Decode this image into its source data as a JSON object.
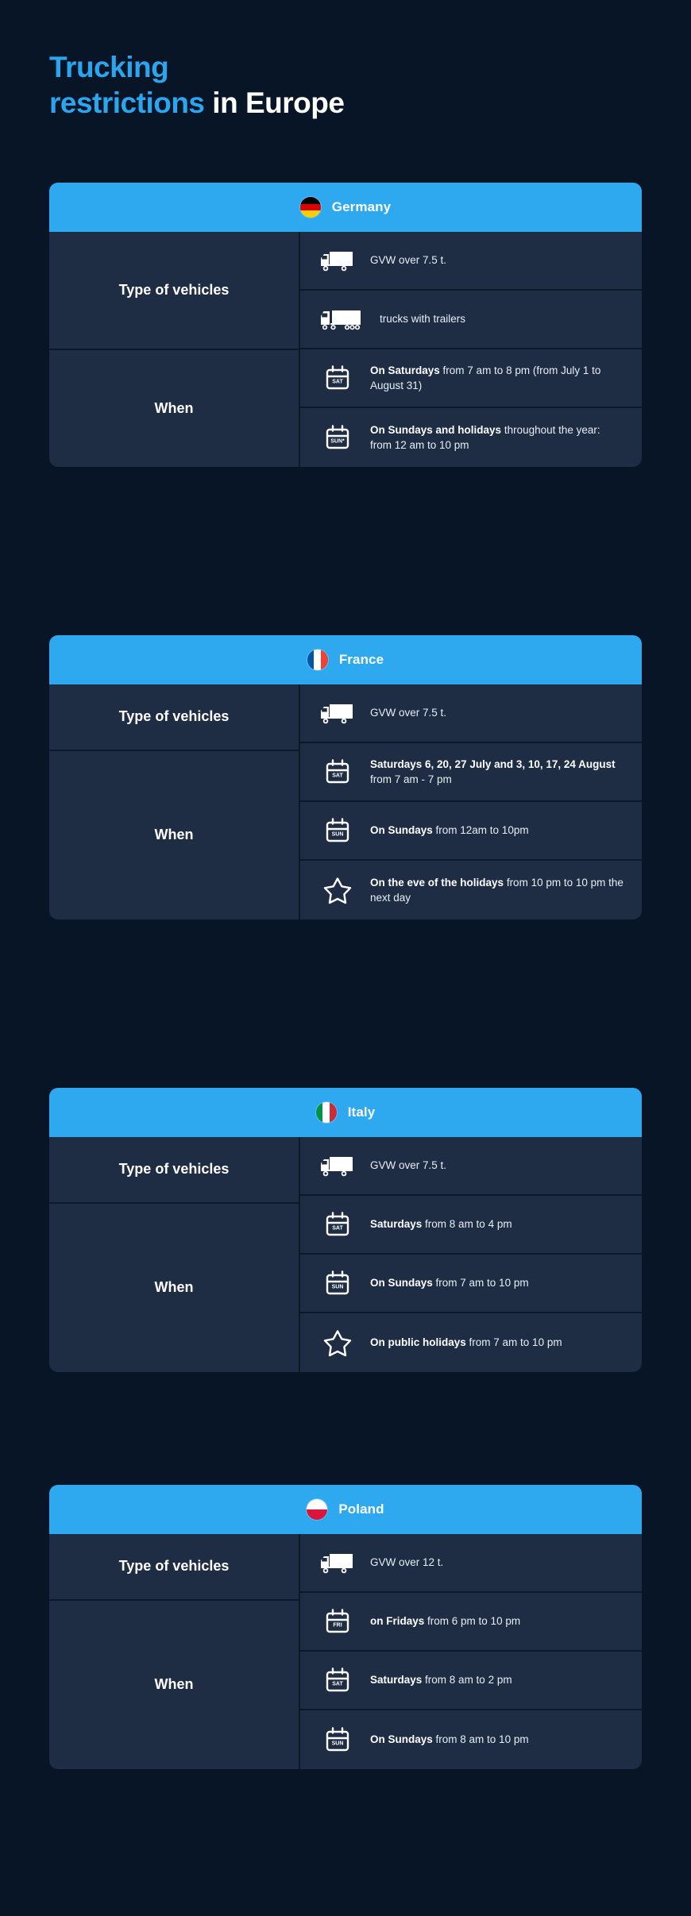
{
  "title": {
    "line1_blue": "Trucking",
    "line2_blue": "restrictions",
    "line2_white": " in Europe"
  },
  "colors": {
    "accent": "#2EA9F0",
    "title_blue": "#2BA6EE",
    "cell_bg": "#1E2D44",
    "page_bg": "#081526"
  },
  "countries": [
    {
      "name": "Germany",
      "flag": {
        "type": "horizontal",
        "stripes": [
          "#000000",
          "#DD0000",
          "#FFCE00"
        ]
      },
      "groups": [
        {
          "label": "Type of vehicles",
          "rows": [
            {
              "icon": "box-truck-icon",
              "bold": "",
              "text": "GVW over 7.5 t."
            },
            {
              "icon": "truck-trailer-icon",
              "bold": "",
              "text": "trucks with trailers"
            }
          ]
        },
        {
          "label": "When",
          "rows": [
            {
              "icon": "calendar-sat-icon",
              "icon_label": "SAT",
              "bold": "On Saturdays",
              "text": " from 7 am to 8 pm (from July 1 to August 31)"
            },
            {
              "icon": "calendar-sun-icon",
              "icon_label": "SUN*",
              "bold": "On Sundays and holidays",
              "text": "throughout the year: from 12 am to 10 pm"
            }
          ]
        }
      ]
    },
    {
      "name": "France",
      "flag": {
        "type": "vertical",
        "stripes": [
          "#0055A4",
          "#FFFFFF",
          "#EF4135"
        ]
      },
      "groups": [
        {
          "label": "Type of vehicles",
          "rows": [
            {
              "icon": "box-truck-icon",
              "bold": "",
              "text": "GVW over 7.5 t."
            }
          ]
        },
        {
          "label": "When",
          "rows": [
            {
              "icon": "calendar-sat-icon",
              "icon_label": "SAT",
              "bold": "Saturdays 6, 20, 27 July and 3, 10, 17, 24 August",
              "text": "from 7 am - 7 pm"
            },
            {
              "icon": "calendar-sun-icon",
              "icon_label": "SUN",
              "bold": "On Sundays",
              "text": "from 12am to 10pm"
            },
            {
              "icon": "star-icon",
              "icon_label": "",
              "bold": "On the eve of the holidays",
              "text": "from 10 pm to 10 pm the next day"
            }
          ]
        }
      ]
    },
    {
      "name": "Italy",
      "flag": {
        "type": "vertical",
        "stripes": [
          "#009246",
          "#FFFFFF",
          "#CE2B37"
        ]
      },
      "groups": [
        {
          "label": "Type of vehicles",
          "rows": [
            {
              "icon": "box-truck-icon",
              "bold": "",
              "text": "GVW over 7.5 t."
            }
          ]
        },
        {
          "label": "When",
          "rows": [
            {
              "icon": "calendar-sat-icon",
              "icon_label": "SAT",
              "bold": "Saturdays",
              "text": "from 8 am to 4 pm"
            },
            {
              "icon": "calendar-sun-icon",
              "icon_label": "SUN",
              "bold": "On Sundays",
              "text": "from 7 am to 10 pm"
            },
            {
              "icon": "star-icon",
              "icon_label": "",
              "bold": "On public holidays",
              "text": "from 7 am to 10 pm"
            }
          ]
        }
      ]
    },
    {
      "name": "Poland",
      "flag": {
        "type": "horizontal",
        "stripes": [
          "#FFFFFF",
          "#DC143C"
        ]
      },
      "groups": [
        {
          "label": "Type of vehicles",
          "rows": [
            {
              "icon": "box-truck-icon",
              "bold": "",
              "text": "GVW over 12 t."
            }
          ]
        },
        {
          "label": "When",
          "rows": [
            {
              "icon": "calendar-fri-icon",
              "icon_label": "FRI",
              "bold": "on Fridays",
              "text": "from 6 pm to 10 pm"
            },
            {
              "icon": "calendar-sat-icon",
              "icon_label": "SAT",
              "bold": "Saturdays",
              "text": "from 8 am to 2 pm"
            },
            {
              "icon": "calendar-sun-icon",
              "icon_label": "SUN",
              "bold": "On Sundays",
              "text": "from 8 am to 10 pm"
            }
          ]
        }
      ]
    }
  ]
}
